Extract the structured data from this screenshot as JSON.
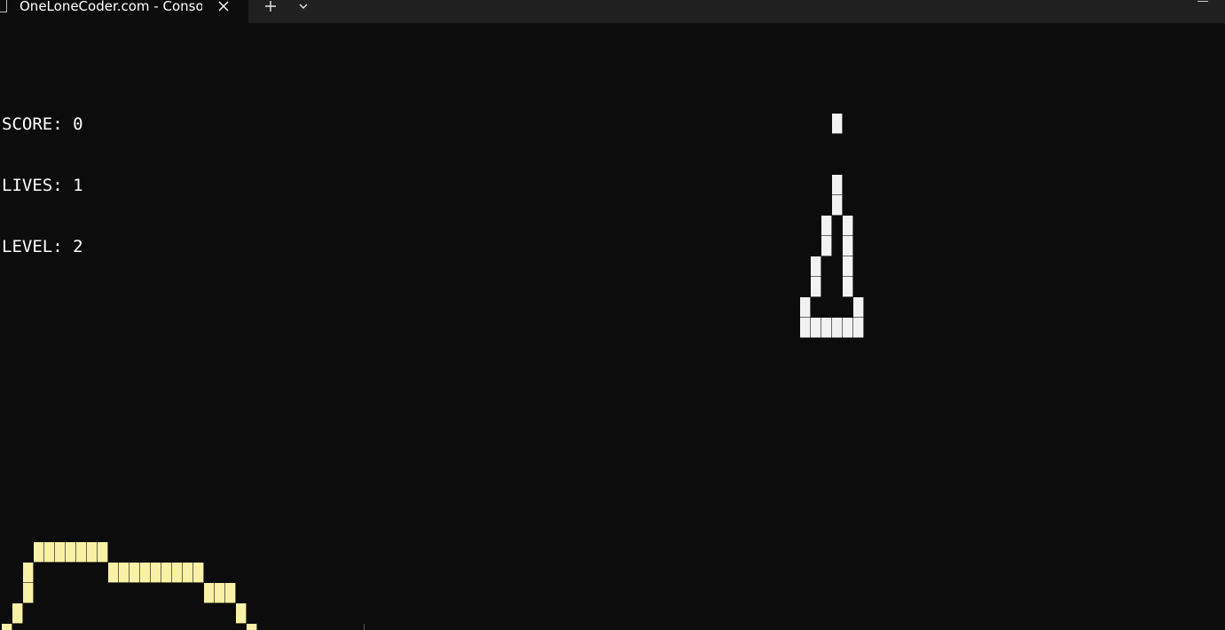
{
  "tab": {
    "title": "OneLoneCoder.com - Console",
    "close_icon": "close-icon"
  },
  "titlebar": {
    "new_tab_icon": "plus-icon",
    "dropdown_icon": "chevron-down-icon",
    "minimize_icon": "minimize-icon"
  },
  "hud": {
    "score": "SCORE: 0",
    "lives": "LIVES: 1",
    "level": "LEVEL: 2"
  },
  "colors": {
    "background": "#0c0c0c",
    "ship": "#f2f2f2",
    "terrain": "#f9f1a5"
  }
}
